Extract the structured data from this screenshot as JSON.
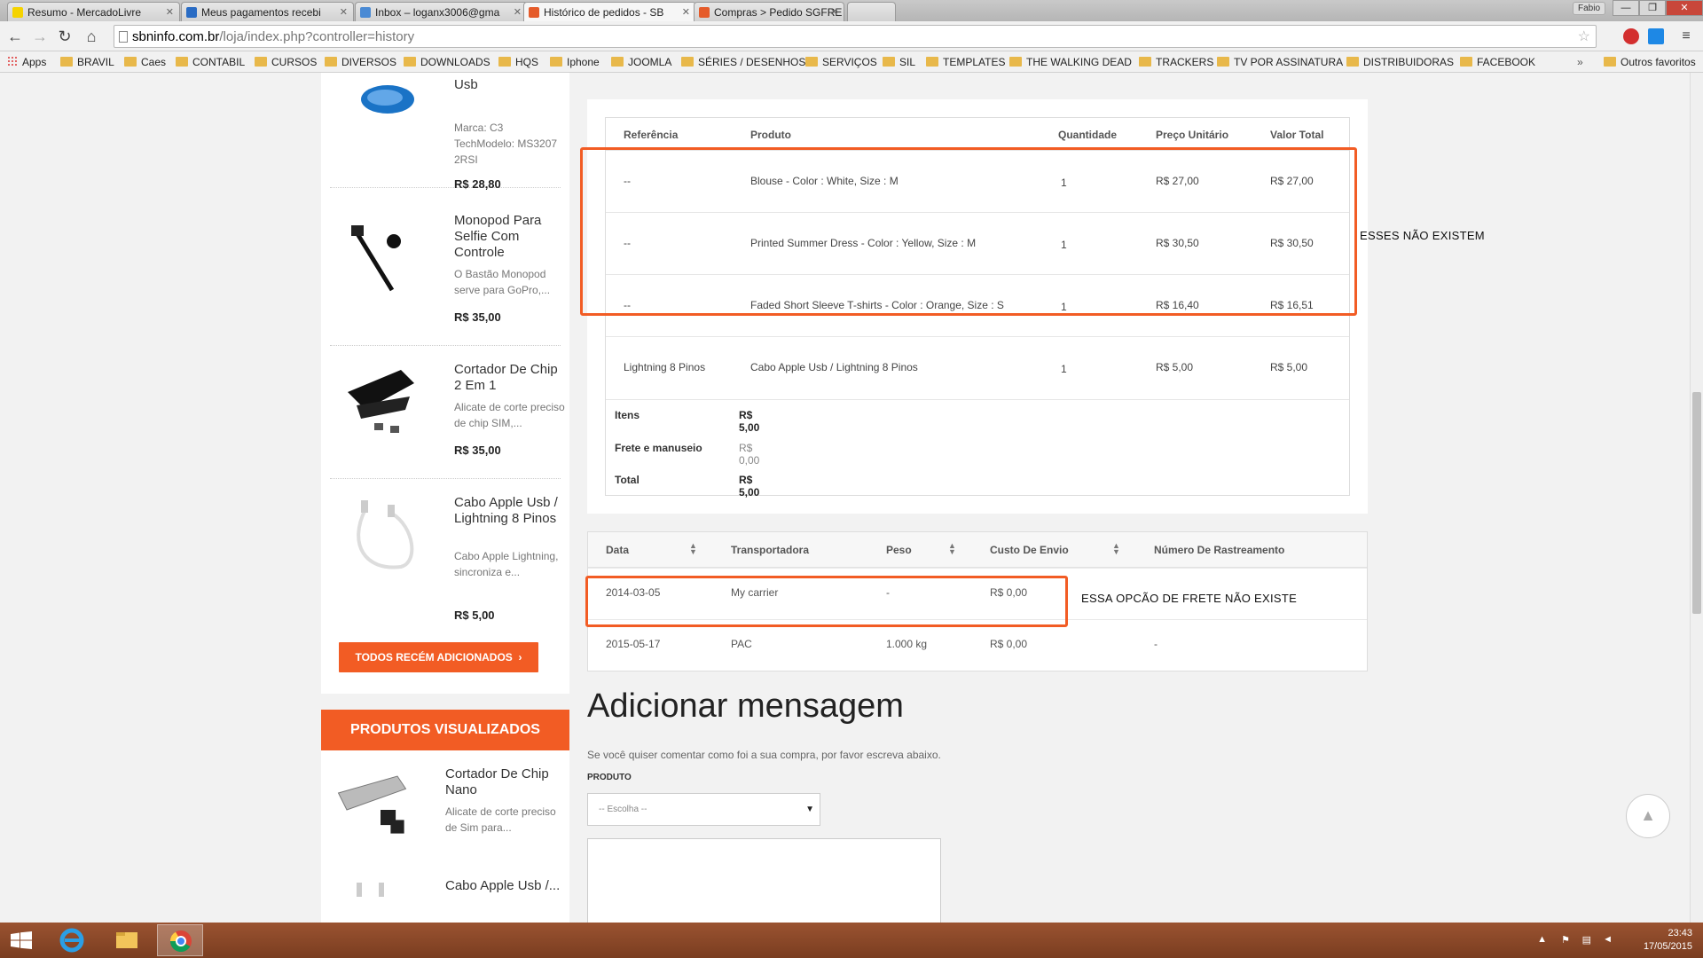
{
  "browser": {
    "tabs": [
      {
        "label": "Resumo - MercadoLivre",
        "fav_color": "#f5d300"
      },
      {
        "label": "Meus pagamentos recebi",
        "fav_color": "#2a6cc4"
      },
      {
        "label": "Inbox – loganx3006@gma",
        "fav_color": "#4a8ad4"
      },
      {
        "label": "Histórico de pedidos - SB",
        "fav_color": "#e55b2a"
      },
      {
        "label": "Compras > Pedido SGFRE",
        "fav_color": "#e55b2a"
      }
    ],
    "profile": "Fabio",
    "window_controls": {
      "minimize": "—",
      "maximize": "❐",
      "close": "✕"
    },
    "url_host": "sbninfo.com.br",
    "url_path": "/loja/index.php?controller=history",
    "bookmarks": [
      "Apps",
      "BRAVIL",
      "Caes",
      "CONTABIL",
      "CURSOS",
      "DIVERSOS",
      "DOWNLOADS",
      "HQS",
      "Iphone",
      "JOOMLA",
      "SÉRIES / DESENHOS",
      "SERVIÇOS",
      "SIL",
      "TEMPLATES",
      "THE WALKING DEAD",
      "TRACKERS",
      "TV POR ASSINATURA",
      "DISTRIBUIDORAS",
      "FACEBOOK"
    ],
    "other_bookmarks": "Outros favoritos"
  },
  "left_col": {
    "products": [
      {
        "name": "Usb",
        "desc": "Marca: C3 TechModelo: MS3207 2RSI",
        "price": "R$ 28,80"
      },
      {
        "name": "Monopod Para Selfie Com Controle",
        "desc": "O Bastão Monopod serve para GoPro,...",
        "price": "R$ 35,00"
      },
      {
        "name": "Cortador De Chip 2 Em 1",
        "desc": "Alicate de corte preciso de chip SIM,...",
        "price": "R$ 35,00"
      },
      {
        "name": "Cabo Apple Usb / Lightning 8 Pinos",
        "desc": "Cabo Apple Lightning, sincroniza e...",
        "price": "R$ 5,00"
      }
    ],
    "todos_button": "TODOS RECÉM ADICIONADOS",
    "visited_header": "PRODUTOS VISUALIZADOS",
    "visited": [
      {
        "name": "Cortador De Chip Nano",
        "desc": "Alicate de corte preciso de Sim para..."
      },
      {
        "name": "Cabo Apple Usb /..."
      }
    ]
  },
  "order": {
    "headers": {
      "ref": "Referência",
      "prod": "Produto",
      "qty": "Quantidade",
      "unit": "Preço Unitário",
      "total": "Valor Total"
    },
    "rows": [
      {
        "ref": "--",
        "prod": "Blouse - Color : White, Size : M",
        "qty": "1",
        "unit": "R$ 27,00",
        "total": "R$ 27,00"
      },
      {
        "ref": "--",
        "prod": "Printed Summer Dress - Color : Yellow, Size : M",
        "qty": "1",
        "unit": "R$ 30,50",
        "total": "R$ 30,50"
      },
      {
        "ref": "--",
        "prod": "Faded Short Sleeve T-shirts - Color : Orange, Size : S",
        "qty": "1",
        "unit": "R$ 16,40",
        "total": "R$ 16,51"
      },
      {
        "ref": "Lightning 8 Pinos",
        "prod": "Cabo Apple Usb / Lightning 8 Pinos",
        "qty": "1",
        "unit": "R$ 5,00",
        "total": "R$ 5,00"
      }
    ],
    "totals": [
      {
        "label": "Itens",
        "value": "R$ 5,00"
      },
      {
        "label": "Frete e manuseio",
        "value": "R$ 0,00"
      },
      {
        "label": "Total",
        "value": "R$ 5,00"
      }
    ]
  },
  "shipping": {
    "headers": {
      "date": "Data",
      "carrier": "Transportadora",
      "weight": "Peso",
      "cost": "Custo De Envio",
      "tracking": "Número De Rastreamento"
    },
    "rows": [
      {
        "date": "2014-03-05",
        "carrier": "My carrier",
        "weight": "-",
        "cost": "R$ 0,00",
        "tracking": ""
      },
      {
        "date": "2015-05-17",
        "carrier": "PAC",
        "weight": "1.000 kg",
        "cost": "R$ 0,00",
        "tracking": "-"
      }
    ]
  },
  "message": {
    "title": "Adicionar mensagem",
    "hint": "Se você quiser comentar como foi a sua compra, por favor escreva abaixo.",
    "label": "PRODUTO",
    "select_value": "-- Escolha --"
  },
  "annotations": {
    "products_note": "ESSES NÃO EXISTEM",
    "carrier_note": "ESSA OPCÃO DE FRETE NÃO EXISTE"
  },
  "taskbar": {
    "time": "23:43",
    "date": "17/05/2015"
  },
  "colors": {
    "accent": "#f25c24",
    "taskbar": "#8c4a2a"
  }
}
